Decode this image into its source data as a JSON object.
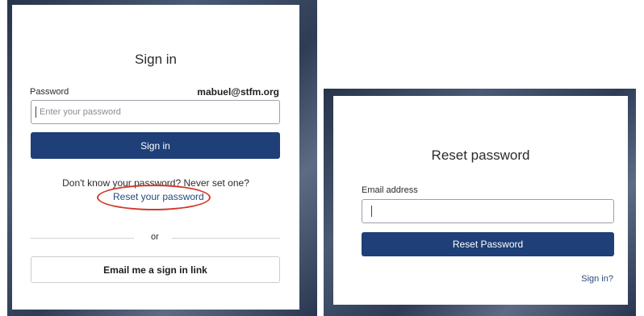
{
  "sign_in_card": {
    "title": "Sign in",
    "password_label": "Password",
    "account_email": "mabuel@stfm.org",
    "password_placeholder": "Enter your password",
    "submit_label": "Sign in",
    "help_text": "Don't know your password? Never set one?",
    "reset_link": "Reset your password",
    "divider_text": "or",
    "email_link_button": "Email me a sign in link"
  },
  "reset_card": {
    "title": "Reset password",
    "email_label": "Email address",
    "email_value": "",
    "submit_label": "Reset Password",
    "sign_in_link": "Sign in?"
  },
  "colors": {
    "primary_button": "#1e3f77",
    "annotation": "#d23a2b",
    "link": "#2a4a7c"
  }
}
